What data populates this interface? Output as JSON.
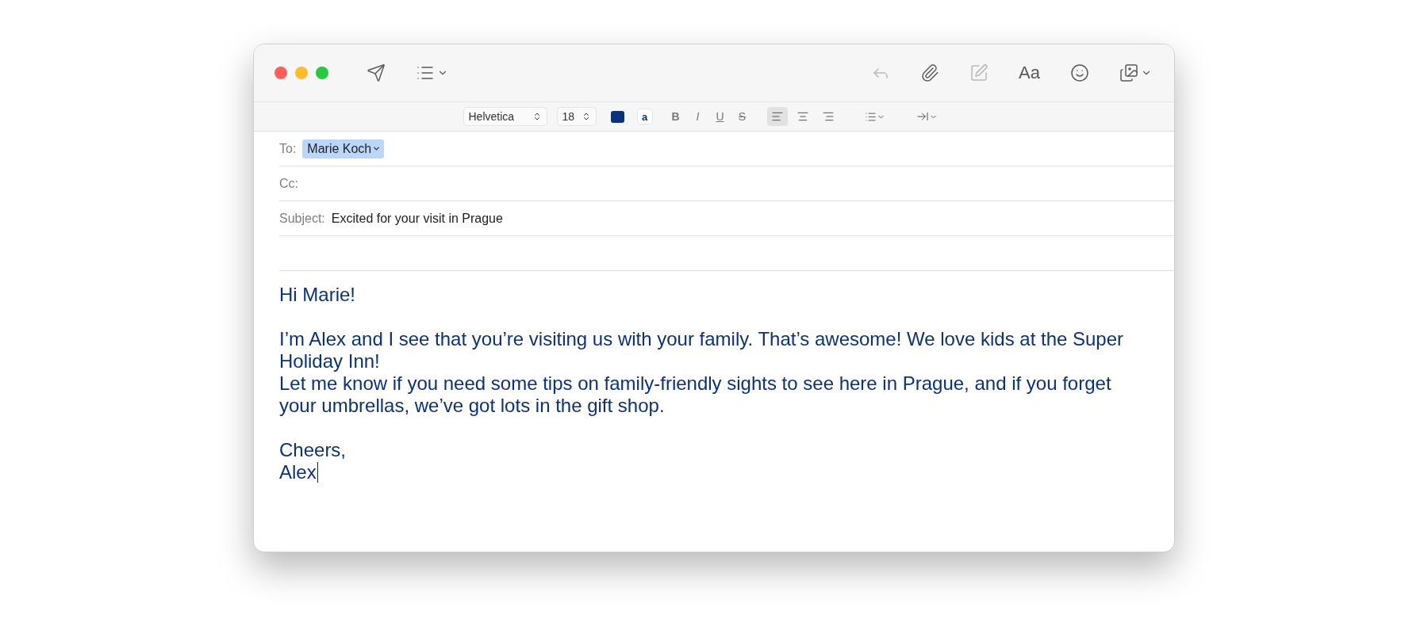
{
  "toolbar": {
    "buttons": [
      {
        "kind": "send",
        "disabled": false,
        "menu": false
      },
      {
        "kind": "list",
        "disabled": false,
        "menu": true
      },
      {
        "kind": "reply",
        "disabled": true,
        "menu": false
      },
      {
        "kind": "attach",
        "disabled": false,
        "menu": false
      },
      {
        "kind": "markup",
        "disabled": true,
        "menu": false
      },
      {
        "kind": "fonts",
        "label": "Aa",
        "disabled": false,
        "menu": false
      },
      {
        "kind": "emoji",
        "disabled": false,
        "menu": false
      },
      {
        "kind": "photos",
        "disabled": false,
        "menu": true
      }
    ]
  },
  "format_bar": {
    "font": "Helvetica",
    "size": "18",
    "highlight_label": "a",
    "styles": [
      {
        "label": "B",
        "kind": "bold"
      },
      {
        "label": "I",
        "kind": "italic"
      },
      {
        "label": "U",
        "kind": "underline"
      },
      {
        "label": "S",
        "kind": "strike"
      }
    ],
    "alignment": [
      {
        "kind": "left",
        "selected": true
      },
      {
        "kind": "center",
        "selected": false
      },
      {
        "kind": "right",
        "selected": false
      }
    ]
  },
  "header": {
    "to": {
      "label": "To:",
      "recipients": [
        {
          "name": "Marie Koch",
          "selected": true
        }
      ]
    },
    "cc": {
      "label": "Cc:"
    },
    "subject": {
      "label": "Subject:",
      "value": "Excited for your visit in Prague"
    }
  },
  "body": {
    "blocks": [
      {
        "paragraphs": [
          "Hi Marie!"
        ]
      },
      {
        "paragraphs": [
          "I’m Alex and I see that you’re visiting us with your family. That’s awesome! We love kids at the Super Holiday Inn!",
          "Let me know if you need some tips on family-friendly sights to see here in Prague, and if you forget your umbrellas, we’ve got lots in the gift shop."
        ]
      },
      {
        "paragraphs": [
          "Cheers,",
          "Alex"
        ]
      }
    ]
  }
}
